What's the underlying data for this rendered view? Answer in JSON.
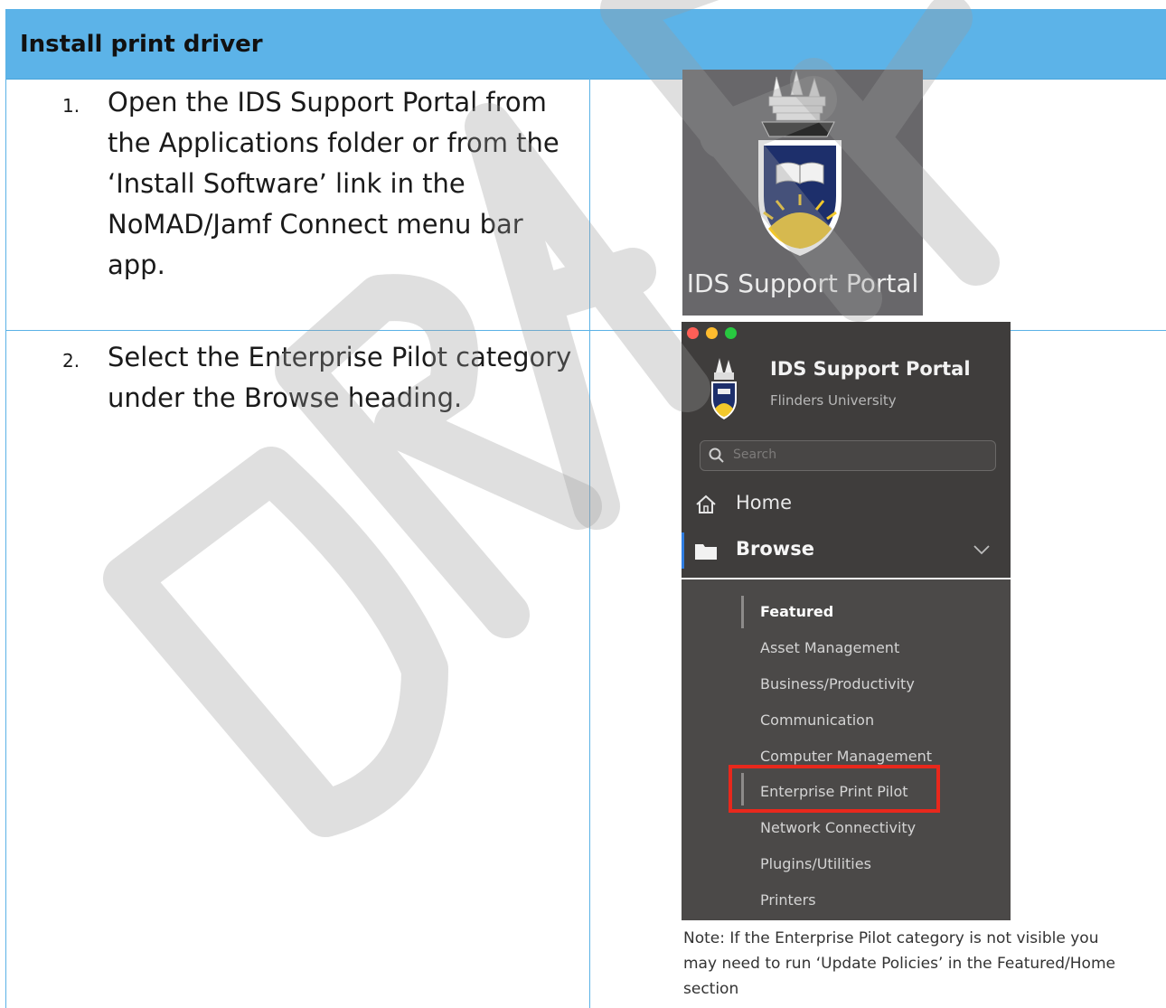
{
  "header": {
    "title": "Install print driver"
  },
  "steps": [
    {
      "number": "1.",
      "text": "Open the IDS Support Portal from the Applications folder or from the ‘Install Software’ link in the NoMAD/Jamf Connect menu bar app."
    },
    {
      "number": "2.",
      "text": "Select the Enterprise Pilot category under the Browse heading."
    }
  ],
  "app_icon": {
    "label": "IDS Support Portal"
  },
  "portal": {
    "title": "IDS Support Portal",
    "subtitle": "Flinders University",
    "search_placeholder": "Search",
    "home_label": "Home",
    "browse_label": "Browse",
    "categories": [
      "Featured",
      "Asset Management",
      "Business/Productivity",
      "Communication",
      "Computer Management",
      "Enterprise Print Pilot",
      "Network Connectivity",
      "Plugins/Utilities",
      "Printers"
    ],
    "selected_category": "Featured",
    "highlighted_category": "Enterprise Print Pilot"
  },
  "note": "Note: If the Enterprise Pilot category is not visible you may need to run ‘Update Policies’ in the Featured/Home section",
  "watermark": "DRAFT",
  "colors": {
    "header_bg": "#5cb3e8",
    "border": "#5bb2e6",
    "highlight": "#e8281c",
    "sidebar_bg": "#4b4948"
  }
}
